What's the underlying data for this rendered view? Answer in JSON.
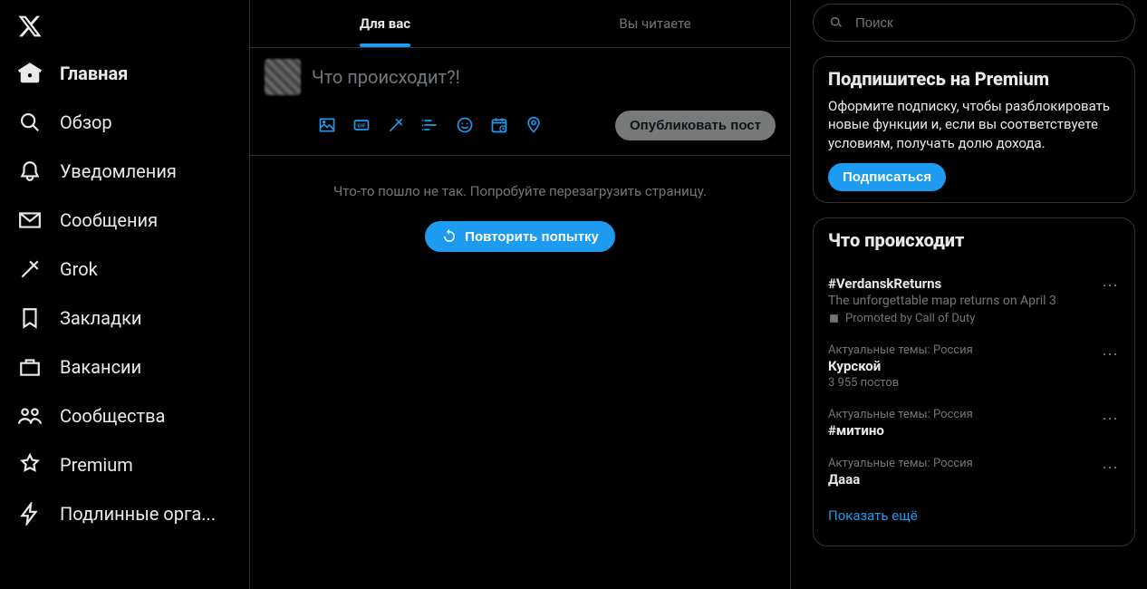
{
  "nav": {
    "home": "Главная",
    "explore": "Обзор",
    "notifications": "Уведомления",
    "messages": "Сообщения",
    "grok": "Grok",
    "bookmarks": "Закладки",
    "jobs": "Вакансии",
    "communities": "Сообщества",
    "premium": "Premium",
    "verified_orgs": "Подлинные орга..."
  },
  "tabs": {
    "for_you": "Для вас",
    "following": "Вы читаете"
  },
  "compose": {
    "placeholder": "Что происходит?!",
    "post_button": "Опубликовать пост"
  },
  "error": {
    "message": "Что-то пошло не так. Попробуйте перезагрузить страницу.",
    "retry": "Повторить попытку"
  },
  "search": {
    "placeholder": "Поиск"
  },
  "premium_card": {
    "title": "Подпишитесь на Premium",
    "body": "Оформите подписку, чтобы разблокировать новые функции и, если вы соответствуете условиям, получать долю дохода.",
    "button": "Подписаться"
  },
  "trends": {
    "title": "Что происходит",
    "items": [
      {
        "context": "",
        "title": "#VerdanskReturns",
        "subtitle": "The unforgettable map returns on April 3",
        "promoted": "Promoted by Call of Duty",
        "count": ""
      },
      {
        "context": "Актуальные темы: Россия",
        "title": "Курской",
        "subtitle": "",
        "promoted": "",
        "count": "3 955 постов"
      },
      {
        "context": "Актуальные темы: Россия",
        "title": "#митино",
        "subtitle": "",
        "promoted": "",
        "count": ""
      },
      {
        "context": "Актуальные темы: Россия",
        "title": "Дааа",
        "subtitle": "",
        "promoted": "",
        "count": ""
      }
    ],
    "show_more": "Показать ещё"
  }
}
